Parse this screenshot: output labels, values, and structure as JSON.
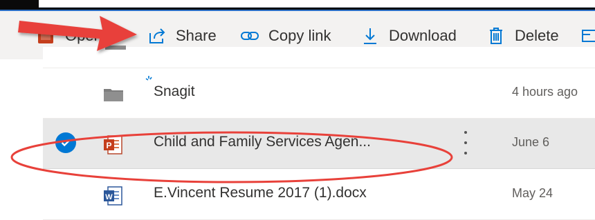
{
  "commandbar": {
    "open_label": "Open",
    "share_label": "Share",
    "copylink_label": "Copy link",
    "download_label": "Download",
    "delete_label": "Delete"
  },
  "files": [
    {
      "name": "Snagit",
      "modified": "4 hours ago",
      "type": "folder",
      "icon": "folder-icon",
      "selected": false
    },
    {
      "name": "Child and Family Services Agen...",
      "modified": "June 6",
      "type": "pptx",
      "icon": "powerpoint-icon",
      "selected": true
    },
    {
      "name": "E.Vincent Resume 2017 (1).docx",
      "modified": "May 24",
      "type": "docx",
      "icon": "word-icon",
      "selected": false
    }
  ],
  "colors": {
    "accent": "#0078d4",
    "annotation": "#e8413a",
    "selected_row": "#e8e8e8",
    "commandbar": "#f3f2f1"
  }
}
